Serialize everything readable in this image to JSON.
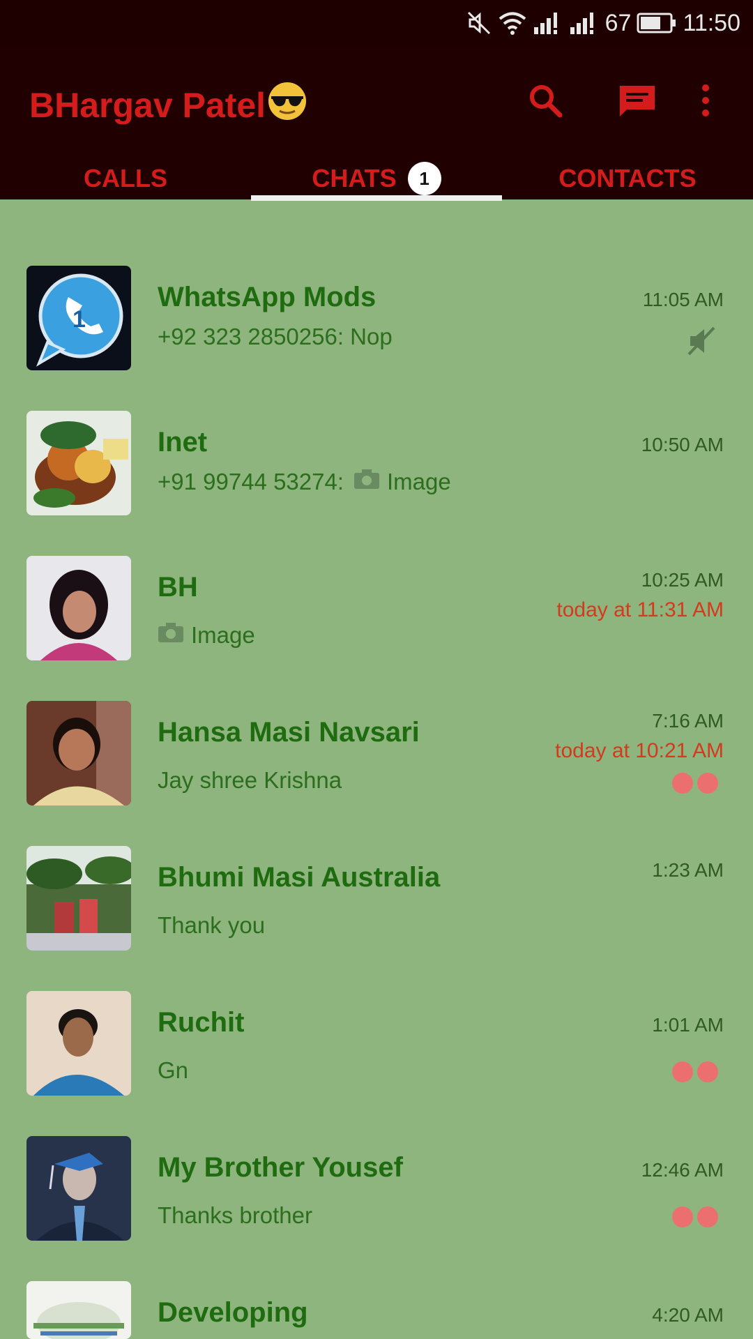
{
  "status_bar": {
    "battery": "67",
    "time": "11:50"
  },
  "header": {
    "title": "BHargav Patel",
    "icons": [
      "sunglasses-emoji",
      "search-icon",
      "new-chat-icon",
      "more-vert-icon"
    ]
  },
  "tabs": [
    {
      "label": "CALLS"
    },
    {
      "label": "CHATS",
      "badge": "1"
    },
    {
      "label": "CONTACTS"
    }
  ],
  "chats": [
    {
      "name": "WhatsApp Mods",
      "message": "+92 323 2850256: Nop",
      "time": "11:05 AM",
      "muted": true
    },
    {
      "name": "Inet",
      "message_prefix": "+91 99744 53274:",
      "message": "Image",
      "time": "10:50 AM"
    },
    {
      "name": "BH",
      "message": "Image",
      "time": "10:25 AM",
      "last_seen": "today at 11:31 AM"
    },
    {
      "name": "Hansa Masi Navsari",
      "message": "Jay shree Krishna",
      "time": "7:16 AM",
      "last_seen": "today at 10:21 AM"
    },
    {
      "name": "Bhumi Masi Australia",
      "message": "Thank you",
      "time": "1:23 AM"
    },
    {
      "name": "Ruchit",
      "message": "Gn",
      "time": "1:01 AM"
    },
    {
      "name": "My Brother Yousef",
      "message": "Thanks brother",
      "time": "12:46 AM"
    },
    {
      "name": "Developing",
      "time": "4:20 AM"
    }
  ],
  "colors": {
    "header_bg": "#200000",
    "accent_red": "#d41c1c",
    "list_bg": "#8db57d",
    "name_green": "#1f6b10",
    "last_seen_red": "#d33a1e",
    "dot_pink": "#ec6f6f"
  }
}
